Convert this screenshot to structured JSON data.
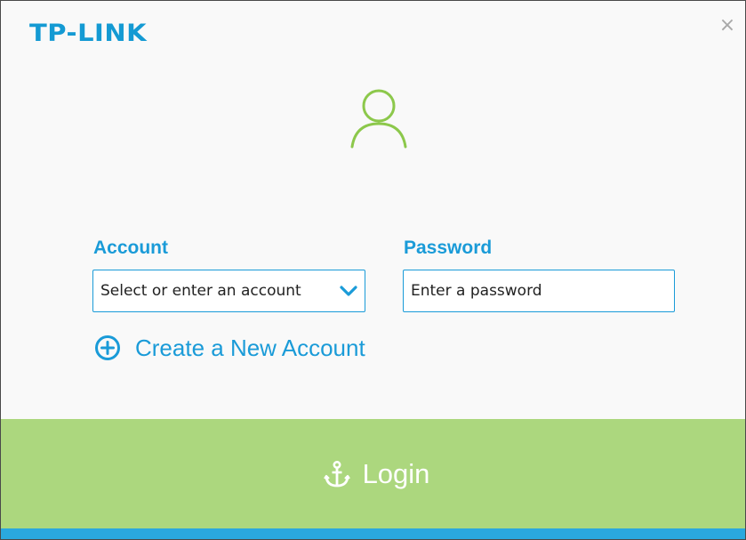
{
  "brand": {
    "logo_text": "TP-LINK",
    "color": "#149ad3"
  },
  "window": {
    "close_glyph": "×"
  },
  "avatar": {
    "icon": "user-outline-icon",
    "color": "#8cc84b"
  },
  "form": {
    "account": {
      "label": "Account",
      "placeholder": "Select or enter an account",
      "dropdown_icon": "chevron-down-icon"
    },
    "password": {
      "label": "Password",
      "placeholder": "Enter a password"
    },
    "create_account": {
      "icon": "plus-circle-icon",
      "label": "Create a New Account"
    }
  },
  "login": {
    "icon": "anchor-icon",
    "label": "Login",
    "bg_color": "#acd77e"
  },
  "colors": {
    "accent": "#1a9bd8",
    "strip": "#2aa8de"
  }
}
